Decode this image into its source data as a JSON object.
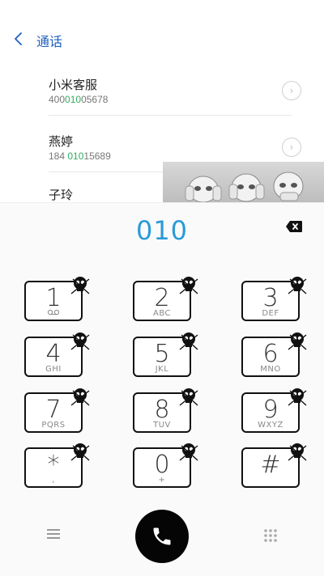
{
  "header": {
    "back_label": "<",
    "title": "通话"
  },
  "contacts": [
    {
      "name": "小米客服",
      "number_parts": [
        "400",
        "010",
        "05678"
      ],
      "chevron": ">"
    },
    {
      "name": "燕婷",
      "number_parts": [
        "184 ",
        "010",
        "15689"
      ],
      "chevron": ">"
    },
    {
      "name": "子玲"
    }
  ],
  "dial": {
    "input_value": "010",
    "backspace_icon": "backspace-icon"
  },
  "keypad": {
    "keys": [
      {
        "digit": "1",
        "letters": "voicemail"
      },
      {
        "digit": "2",
        "letters": "ABC"
      },
      {
        "digit": "3",
        "letters": "DEF"
      },
      {
        "digit": "4",
        "letters": "GHI"
      },
      {
        "digit": "5",
        "letters": "JKL"
      },
      {
        "digit": "6",
        "letters": "MNO"
      },
      {
        "digit": "7",
        "letters": "PQRS"
      },
      {
        "digit": "8",
        "letters": "TUV"
      },
      {
        "digit": "9",
        "letters": "WXYZ"
      },
      {
        "digit": "*",
        "letters": ","
      },
      {
        "digit": "0",
        "letters": "+"
      },
      {
        "digit": "#",
        "letters": ""
      }
    ],
    "overlay_icon": "skull-icon"
  },
  "bottom": {
    "menu_icon": "menu-icon",
    "call_icon": "phone-icon",
    "keypad_icon": "keypad-icon"
  },
  "colors": {
    "accent": "#2a9ad8",
    "highlight": "#2fae61",
    "title": "#1f5fbf",
    "call_button": "#050505"
  }
}
